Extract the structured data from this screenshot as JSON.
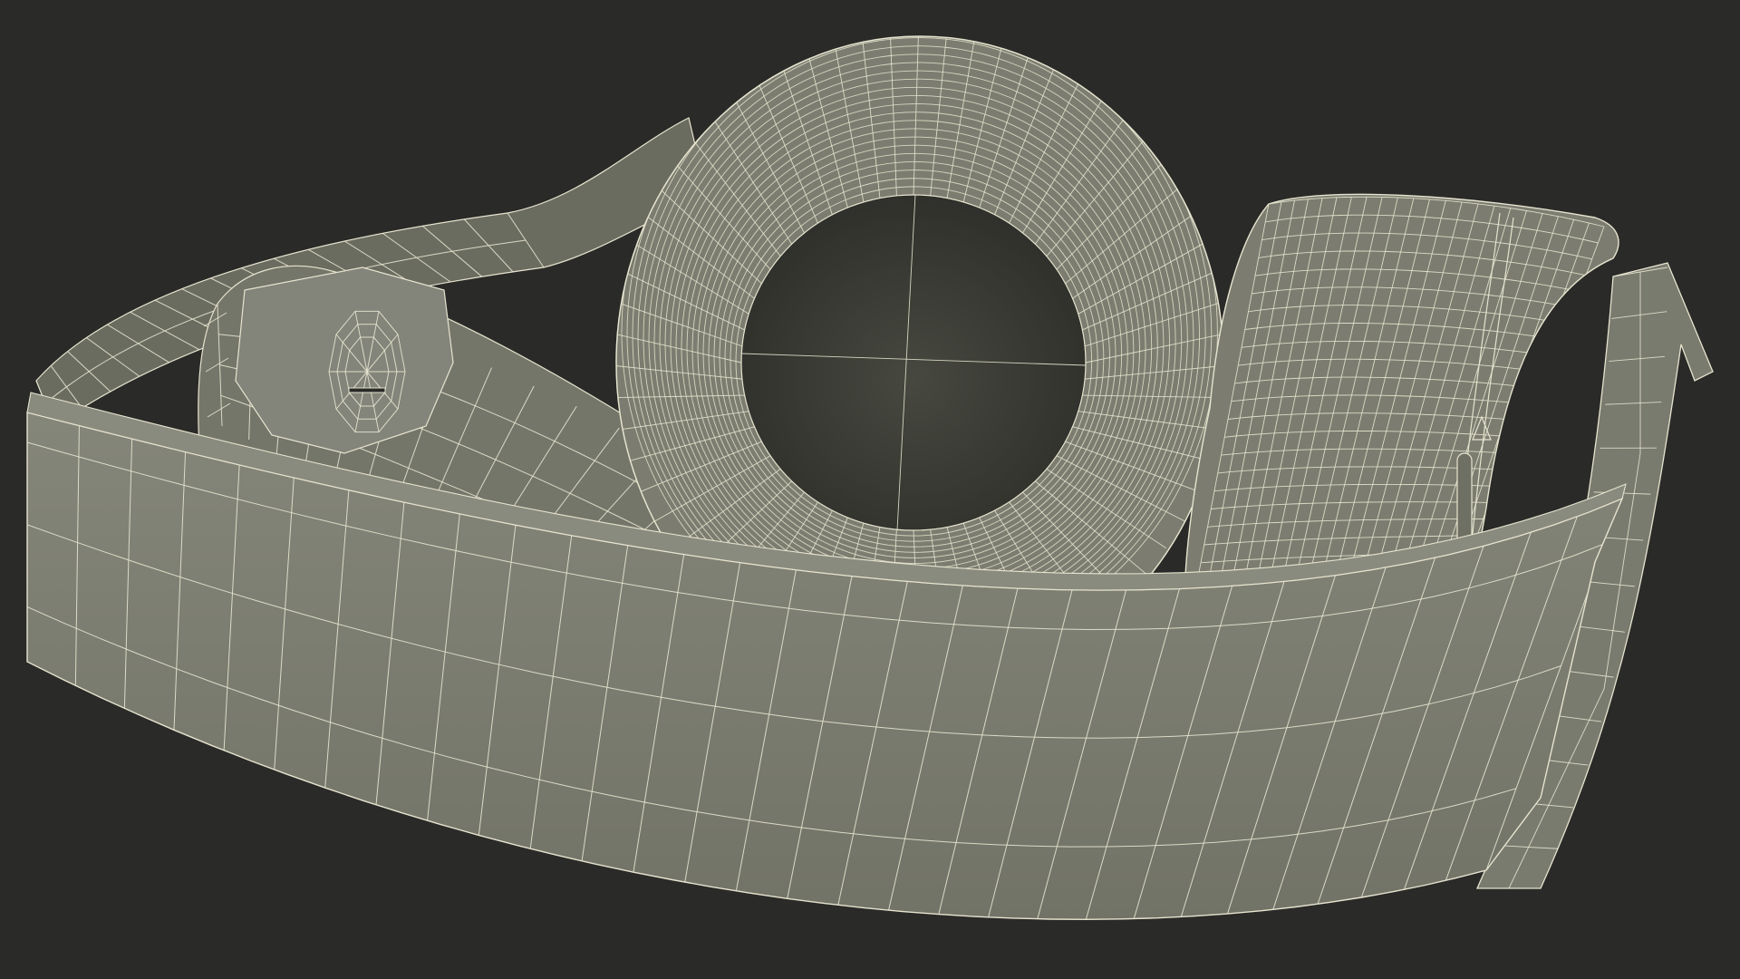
{
  "scene": {
    "background_color": "#2a2a28",
    "surface_color": "#7c7d70",
    "surface_dark_color": "#6b6c60",
    "cavity_color": "#3d3e38",
    "wire_color": "#e6e4cf",
    "subject": "headphones-wireframe-render"
  }
}
